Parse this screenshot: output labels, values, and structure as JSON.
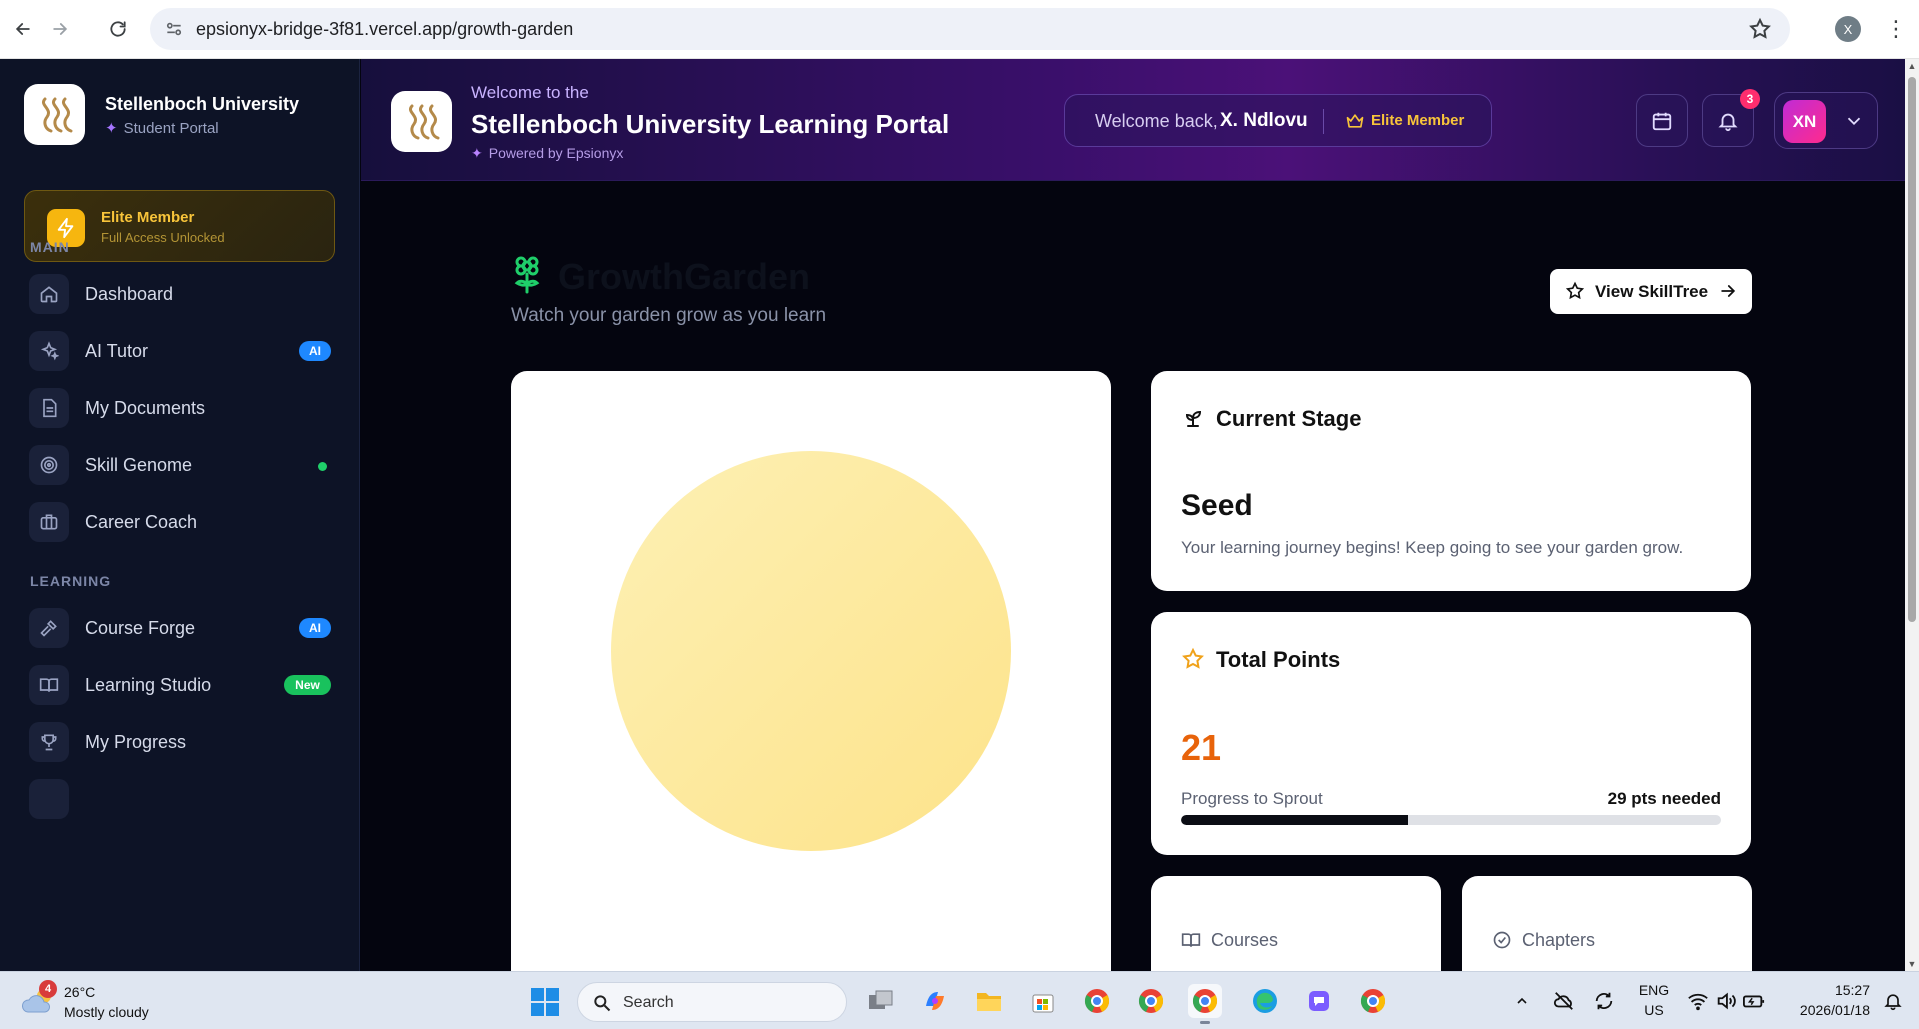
{
  "browser": {
    "url": "epsionyx-bridge-3f81.vercel.app/growth-garden",
    "profile_initial": "X"
  },
  "sidebar": {
    "brand_name": "Stellenboch University",
    "brand_sub": "Student Portal",
    "elite": {
      "title": "Elite Member",
      "subtitle": "Full Access Unlocked"
    },
    "sections": [
      {
        "label": "MAIN",
        "items": [
          {
            "label": "Dashboard",
            "icon": "home-icon",
            "badge": ""
          },
          {
            "label": "AI Tutor",
            "icon": "sparkles-icon",
            "badge": "AI"
          },
          {
            "label": "My Documents",
            "icon": "document-icon",
            "badge": ""
          },
          {
            "label": "Skill Genome",
            "icon": "target-icon",
            "badge": "dot"
          },
          {
            "label": "Career Coach",
            "icon": "briefcase-icon",
            "badge": ""
          }
        ]
      },
      {
        "label": "LEARNING",
        "items": [
          {
            "label": "Course Forge",
            "icon": "hammer-icon",
            "badge": "AI"
          },
          {
            "label": "Learning Studio",
            "icon": "book-open-icon",
            "badge": "New"
          },
          {
            "label": "My Progress",
            "icon": "trophy-icon",
            "badge": ""
          }
        ]
      }
    ]
  },
  "header": {
    "welcome": "Welcome to the",
    "title": "Stellenboch University Learning Portal",
    "powered": "Powered by Epsionyx",
    "welcome_back": "Welcome back,",
    "user_name": "X. Ndlovu",
    "membership": "Elite Member",
    "notification_count": "3",
    "avatar_initials": "XN"
  },
  "main": {
    "page_title": "GrowthGarden",
    "page_subtitle": "Watch your garden grow as you learn",
    "skilltree_button": "View SkillTree",
    "current_stage": {
      "heading": "Current Stage",
      "stage": "Seed",
      "description": "Your learning journey begins! Keep going to see your garden grow."
    },
    "total_points": {
      "heading": "Total Points",
      "value": "21",
      "progress_label": "Progress to Sprout",
      "needed": "29 pts needed",
      "progress_fraction": 0.42
    },
    "courses_label": "Courses",
    "chapters_label": "Chapters"
  },
  "taskbar": {
    "weather_temp": "26°C",
    "weather_desc": "Mostly cloudy",
    "weather_alert": "4",
    "search_label": "Search",
    "language_line1": "ENG",
    "language_line2": "US",
    "time": "15:27",
    "date": "2026/01/18"
  },
  "colors": {
    "accent_green": "#1fcf6a",
    "elite_gold": "#f8c43a",
    "points_orange": "#e8630a",
    "ai_badge": "#1e88ff",
    "new_badge": "#19c25d"
  }
}
